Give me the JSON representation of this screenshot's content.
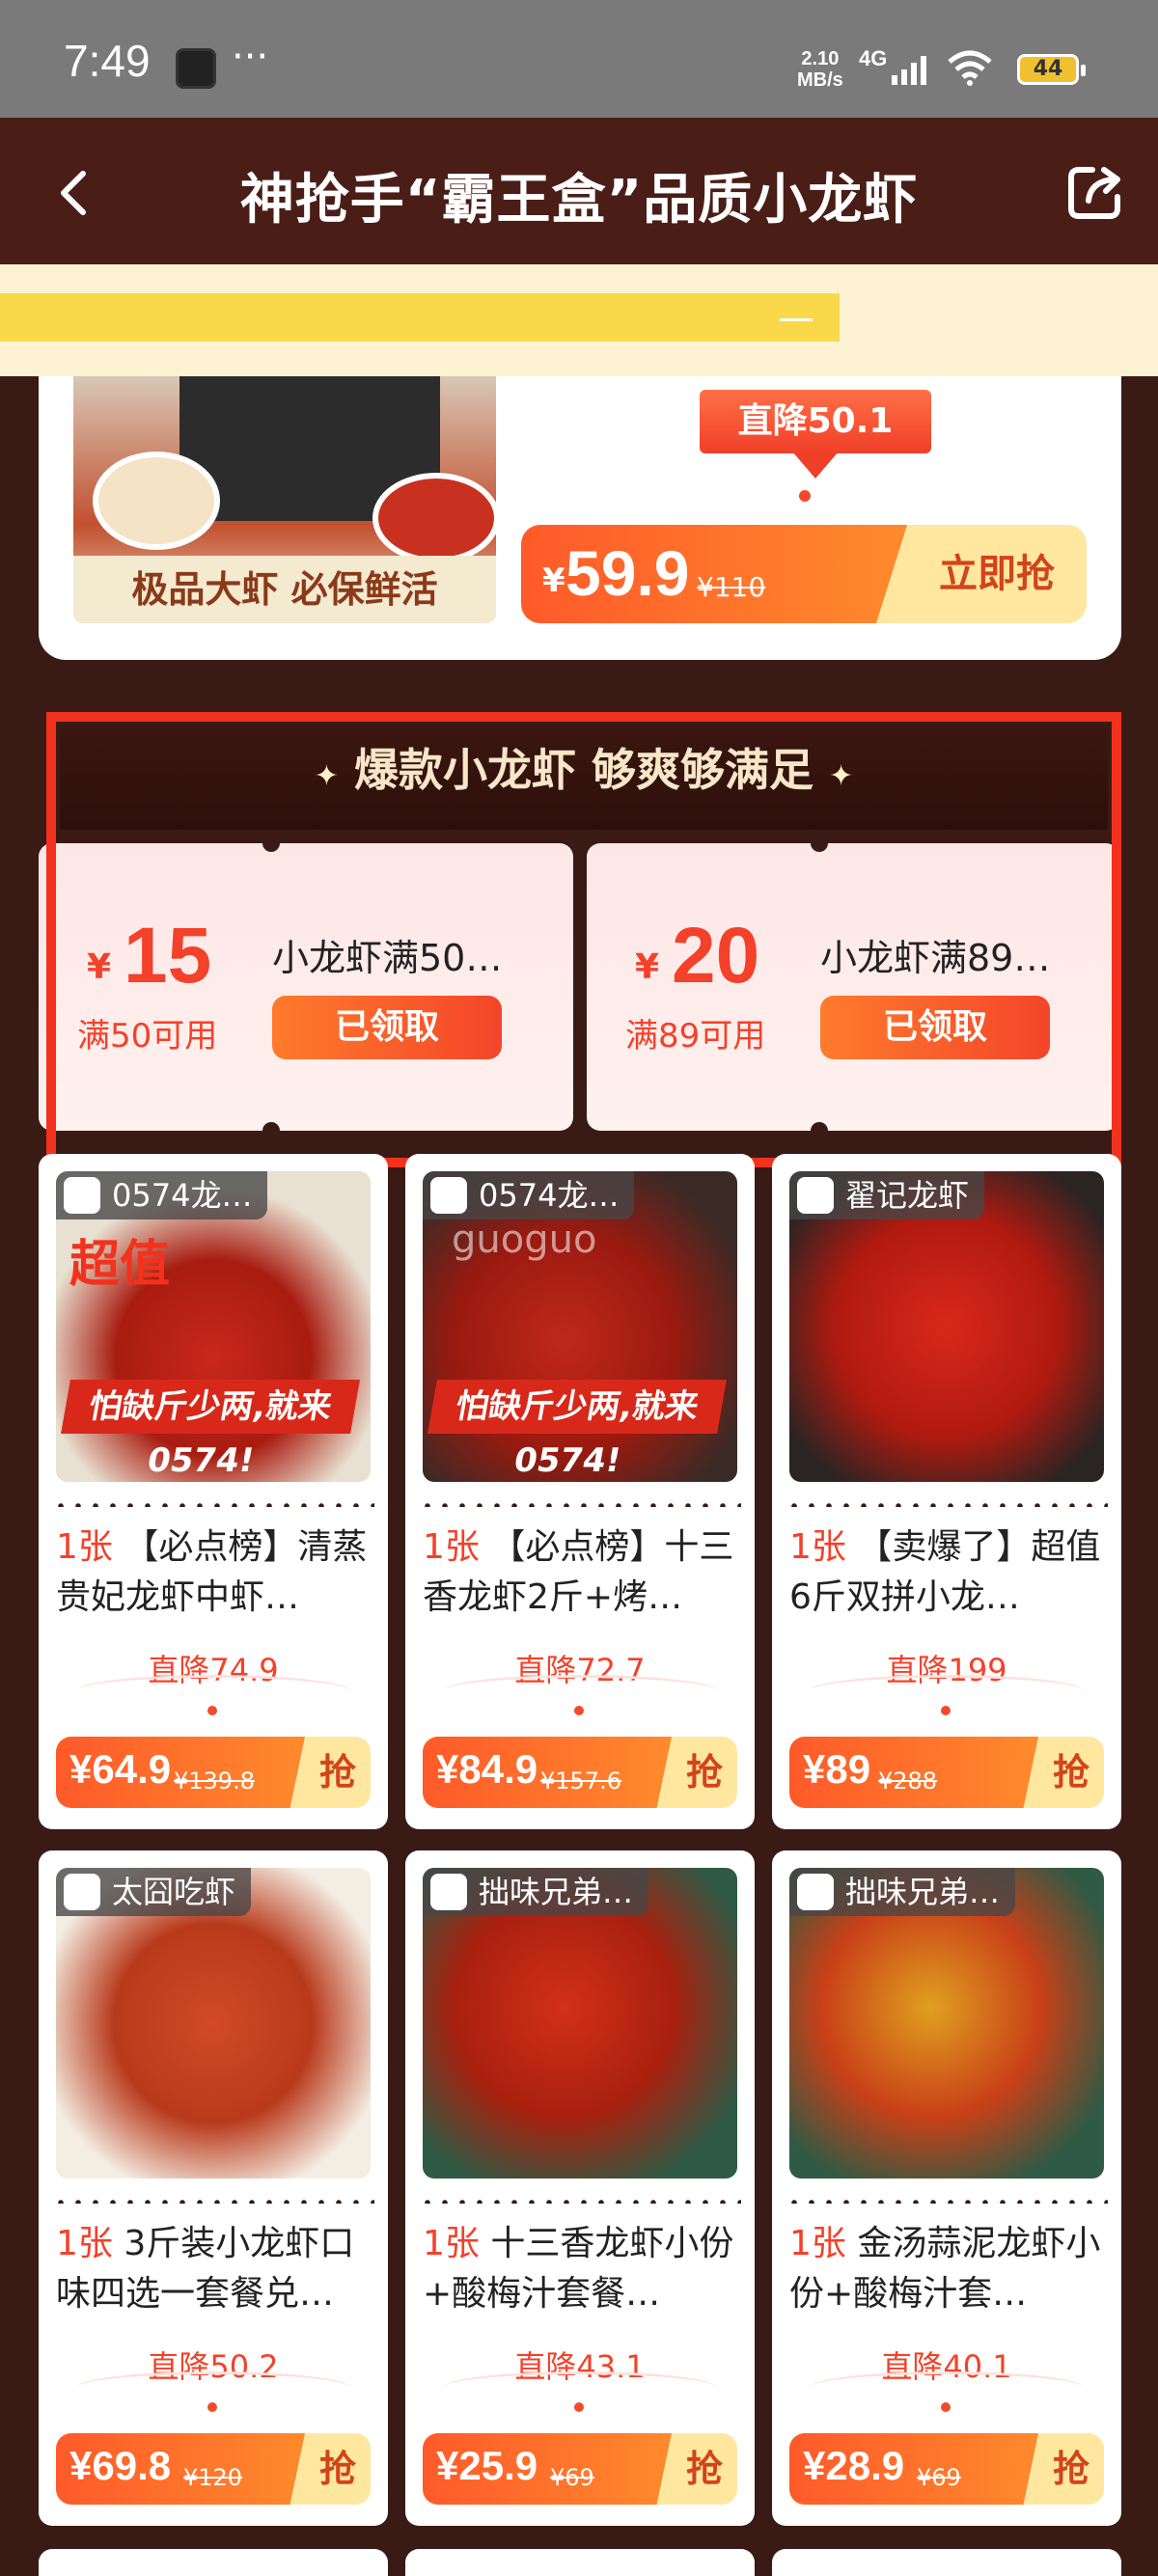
{
  "status": {
    "time": "7:49",
    "dots": "···",
    "speed_top": "2.10",
    "speed_bottom": "MB/s",
    "network": "4G",
    "battery": "44"
  },
  "header": {
    "title": "神抢手“霸王盒”品质小龙虾"
  },
  "hero": {
    "caption": "极品大虾 必保鲜活",
    "drop_label": "直降50.1",
    "yen": "¥",
    "price": "59.9",
    "original": "¥110",
    "buy_label": "立即抢"
  },
  "coupon_section": {
    "heading": "爆款小龙虾 够爽够满足",
    "coupons": [
      {
        "yen": "¥",
        "amount": "15",
        "minimum": "满50可用",
        "desc": "小龙虾满50…",
        "button": "已领取"
      },
      {
        "yen": "¥",
        "amount": "20",
        "minimum": "满89可用",
        "desc": "小龙虾满89…",
        "button": "已领取"
      }
    ]
  },
  "products": [
    {
      "shop": "0574龙…",
      "banner": "怕缺斤少两,就来0574!",
      "badge": "超值",
      "count": "1张",
      "title": "【必点榜】清蒸贵妃龙虾中虾…",
      "drop": "直降74.9",
      "price": "¥64.9",
      "original": "¥139.8",
      "grab": "抢"
    },
    {
      "shop": "0574龙…",
      "banner": "怕缺斤少两,就来0574!",
      "watermark": "guoguo",
      "count": "1张",
      "title": "【必点榜】十三香龙虾2斤+烤…",
      "drop": "直降72.7",
      "price": "¥84.9",
      "original": "¥157.6",
      "grab": "抢"
    },
    {
      "shop": "翟记龙虾",
      "count": "1张",
      "title": "【卖爆了】超值6斤双拼小龙…",
      "drop": "直降199",
      "price": "¥89",
      "original": "¥288",
      "grab": "抢"
    },
    {
      "shop": "太囧吃虾",
      "count": "1张",
      "title": "3斤装小龙虾口味四选一套餐兑…",
      "drop": "直降50.2",
      "price": "¥69.8",
      "original": "¥120",
      "grab": "抢"
    },
    {
      "shop": "拙味兄弟…",
      "count": "1张",
      "title": "十三香龙虾小份+酸梅汁套餐…",
      "drop": "直降43.1",
      "price": "¥25.9",
      "original": "¥69",
      "grab": "抢"
    },
    {
      "shop": "拙味兄弟…",
      "count": "1张",
      "title": "金汤蒜泥龙虾小份+酸梅汁套…",
      "drop": "直降40.1",
      "price": "¥28.9",
      "original": "¥69",
      "grab": "抢"
    }
  ],
  "colors": {
    "accent": "#f4412a",
    "background": "#3a1a14",
    "header": "#4a1e16",
    "highlight_border": "#f2321c"
  }
}
